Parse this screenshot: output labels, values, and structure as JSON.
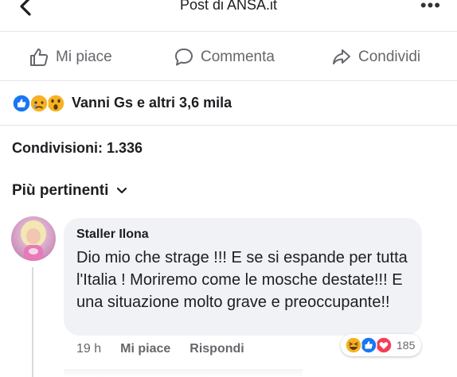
{
  "header": {
    "title": "Post di ANSA.it",
    "back_icon": "chevron-left-icon",
    "more_icon": "more-horizontal-icon",
    "more_label": "•••"
  },
  "actions": [
    {
      "label": "Mi piace",
      "icon": "thumbs-up-icon"
    },
    {
      "label": "Commenta",
      "icon": "comment-icon"
    },
    {
      "label": "Condividi",
      "icon": "share-icon"
    }
  ],
  "reactions": {
    "icons": [
      "like-reaction-icon",
      "sad-reaction-icon",
      "wow-reaction-icon"
    ],
    "text": "Vanni Gs e altri 3,6 mila"
  },
  "shares": {
    "text": "Condivisioni: 1.336"
  },
  "sort": {
    "label": "Più pertinenti",
    "icon": "chevron-down-icon"
  },
  "comment": {
    "author": "Staller Ilona",
    "text": "Dio mio che strage !!! E se si espande per tutta l'Italia  ! Moriremo come le mosche destate!!! E una situazione molto grave e preoccupante!!",
    "time": "19 h",
    "like_label": "Mi piace",
    "reply_label": "Rispondi",
    "reaction_icons": [
      "haha-reaction-icon",
      "like-reaction-icon",
      "love-reaction-icon"
    ],
    "reaction_count": "185"
  },
  "colors": {
    "facebook_blue": "#1877f2",
    "love_red": "#f33e58",
    "reaction_yellow": "#f7b125",
    "secondary_text": "#65676b"
  }
}
